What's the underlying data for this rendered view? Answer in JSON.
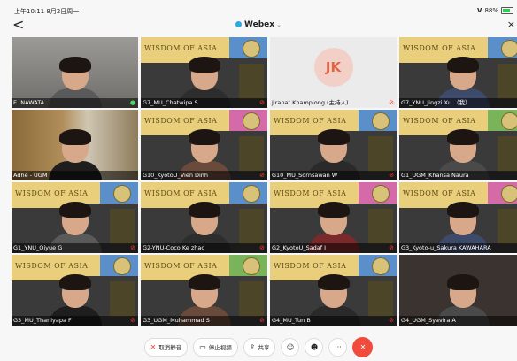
{
  "status": {
    "time": "上午10:11  8月2日周一",
    "battery": "88%"
  },
  "nav": {
    "back": "<",
    "title": "Webex",
    "title_chevron": "⌄",
    "close": "×"
  },
  "participants": [
    {
      "name": "E. NAWATA",
      "mic": "on",
      "video": "room"
    },
    {
      "name": "G7_MU_Chatwipa S",
      "mic": "muted",
      "video": "banner"
    },
    {
      "name": "Jirapat Khamplong  (主持人)",
      "mic": "muted",
      "video": "plain",
      "initials": "JK"
    },
    {
      "name": "G7_YNU_Jingzi Xu （我）",
      "mic": "muted",
      "video": "banner"
    },
    {
      "name": "Adhe - UGM",
      "mic": "none",
      "video": "shelf"
    },
    {
      "name": "G10_KyotoU_Vien Dinh",
      "mic": "muted",
      "video": "banner-pink"
    },
    {
      "name": "G10_MU_Sornsawan W",
      "mic": "muted",
      "video": "banner"
    },
    {
      "name": "G1_UGM_Khansa Naura",
      "mic": "muted",
      "video": "banner-green"
    },
    {
      "name": "G1_YNU_Qiyue G",
      "mic": "muted",
      "video": "banner"
    },
    {
      "name": "G2-YNU-Coco Ke zhao",
      "mic": "muted",
      "video": "banner"
    },
    {
      "name": "G2_KyotoU_Sadaf I",
      "mic": "muted",
      "video": "banner-pink"
    },
    {
      "name": "G3_Kyoto-u_Sakura KAWAHARA",
      "mic": "none",
      "video": "banner-pink"
    },
    {
      "name": "G3_MU_Thaniyapa F",
      "mic": "muted",
      "video": "banner"
    },
    {
      "name": "G3_UGM_Muhammad S",
      "mic": "muted",
      "video": "banner-green"
    },
    {
      "name": "G4_MU_Tun B",
      "mic": "muted",
      "video": "banner"
    },
    {
      "name": "G4_UGM_Syavira A",
      "mic": "muted",
      "video": "dark"
    }
  ],
  "banner_text": "WISDOM OF ASIA",
  "toolbar": {
    "unmute": "取消静音",
    "stop_video": "停止视频",
    "share": "共享",
    "participants_icon": "person-icon",
    "reactions_icon": "smile-icon",
    "more_icon": "more-icon",
    "end_icon": "end-call-icon"
  }
}
